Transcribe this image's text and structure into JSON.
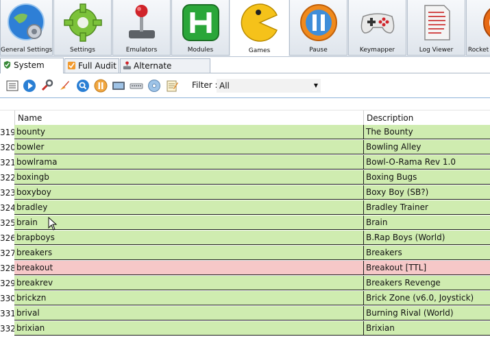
{
  "ribbon": {
    "tabs": [
      {
        "label": "General Settings",
        "icon": "globe-gear-icon"
      },
      {
        "label": "Settings",
        "icon": "gear-icon"
      },
      {
        "label": "Emulators",
        "icon": "joystick-icon"
      },
      {
        "label": "Modules",
        "icon": "h-module-icon"
      },
      {
        "label": "Games",
        "icon": "pacman-icon",
        "active": true
      },
      {
        "label": "Pause",
        "icon": "pause-icon"
      },
      {
        "label": "Keymapper",
        "icon": "gamepad-icon"
      },
      {
        "label": "Log Viewer",
        "icon": "log-document-icon"
      },
      {
        "label": "Rocket",
        "icon": "rocket-launcher-icon"
      }
    ]
  },
  "subtabs": [
    {
      "label": "System Audit",
      "icon": "shield-check-icon",
      "active": true
    },
    {
      "label": "Full Audit",
      "icon": "audit-icon"
    },
    {
      "label": "Alternate Emulators",
      "icon": "alternate-emulator-icon"
    }
  ],
  "toolbar": {
    "icons": [
      "list-icon",
      "play-icon",
      "wrench-icon",
      "rocket-icon",
      "search-icon",
      "pause-icon",
      "monitor-icon",
      "keyboard-icon",
      "disc-icon",
      "notepad-icon"
    ],
    "filter_label": "Filter :",
    "filter_value": "All"
  },
  "grid": {
    "columns": {
      "name": "Name",
      "description": "Description"
    },
    "colors": {
      "ok": "#cfecb0",
      "bad": "#f6c8c8"
    },
    "rows": [
      {
        "num": "319",
        "name": "bounty",
        "description": "The Bounty",
        "status": "ok"
      },
      {
        "num": "320",
        "name": "bowler",
        "description": "Bowling Alley",
        "status": "ok"
      },
      {
        "num": "321",
        "name": "bowlrama",
        "description": "Bowl-O-Rama Rev 1.0",
        "status": "ok"
      },
      {
        "num": "322",
        "name": "boxingb",
        "description": "Boxing Bugs",
        "status": "ok"
      },
      {
        "num": "323",
        "name": "boxyboy",
        "description": "Boxy Boy (SB?)",
        "status": "ok"
      },
      {
        "num": "324",
        "name": "bradley",
        "description": "Bradley Trainer",
        "status": "ok"
      },
      {
        "num": "325",
        "name": "brain",
        "description": "Brain",
        "status": "ok"
      },
      {
        "num": "326",
        "name": "brapboys",
        "description": "B.Rap Boys (World)",
        "status": "ok"
      },
      {
        "num": "327",
        "name": "breakers",
        "description": "Breakers",
        "status": "ok"
      },
      {
        "num": "328",
        "name": "breakout",
        "description": "Breakout [TTL]",
        "status": "bad"
      },
      {
        "num": "329",
        "name": "breakrev",
        "description": "Breakers Revenge",
        "status": "ok"
      },
      {
        "num": "330",
        "name": "brickzn",
        "description": "Brick Zone (v6.0, Joystick)",
        "status": "ok"
      },
      {
        "num": "331",
        "name": "brival",
        "description": "Burning Rival (World)",
        "status": "ok"
      },
      {
        "num": "332",
        "name": "brixian",
        "description": "Brixian",
        "status": "ok"
      }
    ]
  }
}
